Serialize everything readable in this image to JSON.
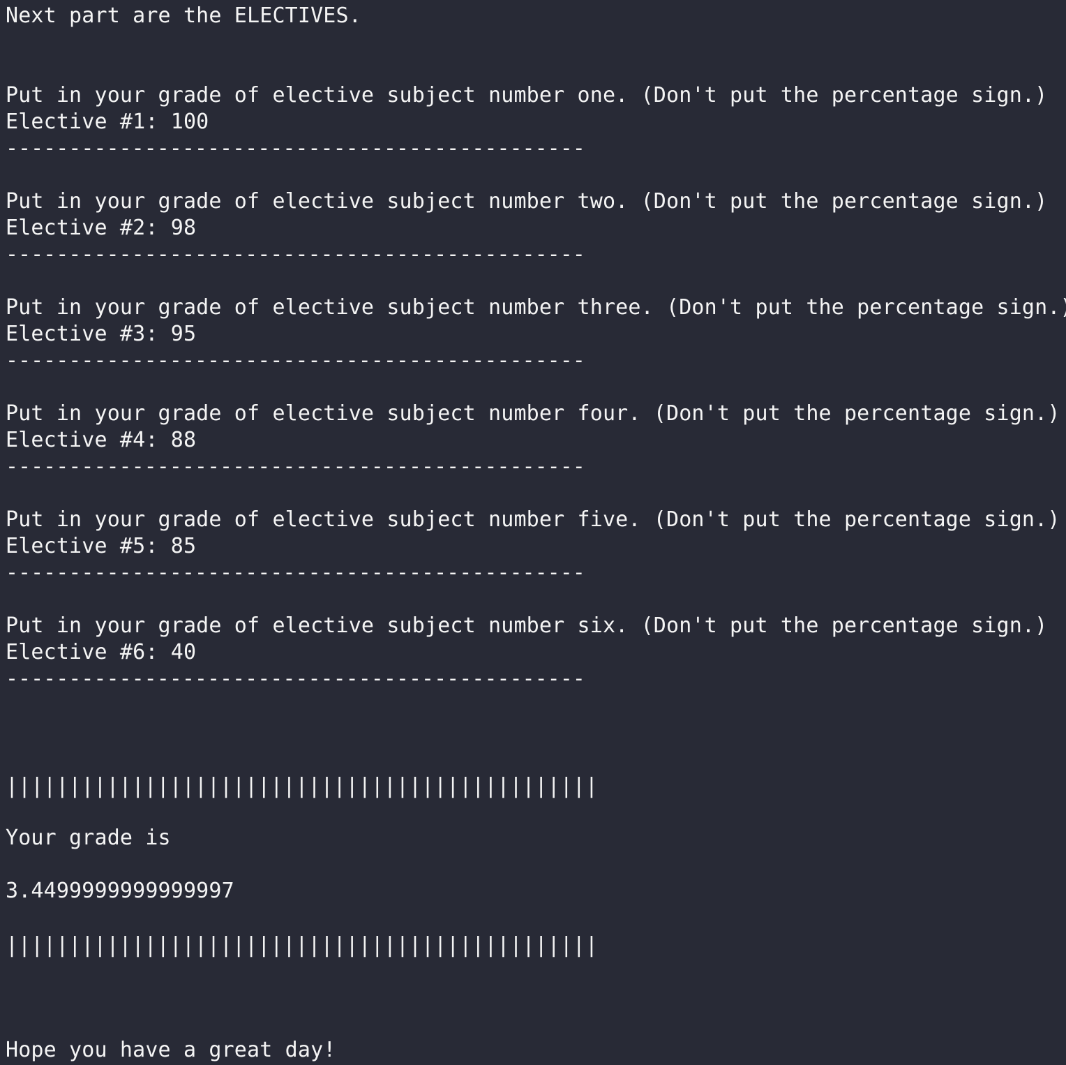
{
  "theme": {
    "background": "#282a36",
    "foreground": "#f4f4f4"
  },
  "terminal": {
    "intro": "Next part are the ELECTIVES.",
    "separator": "----------------------------------------------",
    "electives": [
      {
        "prompt": "Put in your grade of elective subject number one. (Don't put the percentage sign.)",
        "entry": "Elective #1: 100"
      },
      {
        "prompt": "Put in your grade of elective subject number two. (Don't put the percentage sign.)",
        "entry": "Elective #2: 98"
      },
      {
        "prompt": "Put in your grade of elective subject number three. (Don't put the percentage sign.)",
        "entry": "Elective #3: 95"
      },
      {
        "prompt": "Put in your grade of elective subject number four. (Don't put the percentage sign.)",
        "entry": "Elective #4: 88"
      },
      {
        "prompt": "Put in your grade of elective subject number five. (Don't put the percentage sign.)",
        "entry": "Elective #5: 85"
      },
      {
        "prompt": "Put in your grade of elective subject number six. (Don't put the percentage sign.)",
        "entry": "Elective #6: 40"
      }
    ],
    "bar": "|||||||||||||||||||||||||||||||||||||||||||||||",
    "grade_label": "Your grade is",
    "grade_value": "3.4499999999999997",
    "farewell": "Hope you have a great day!"
  }
}
